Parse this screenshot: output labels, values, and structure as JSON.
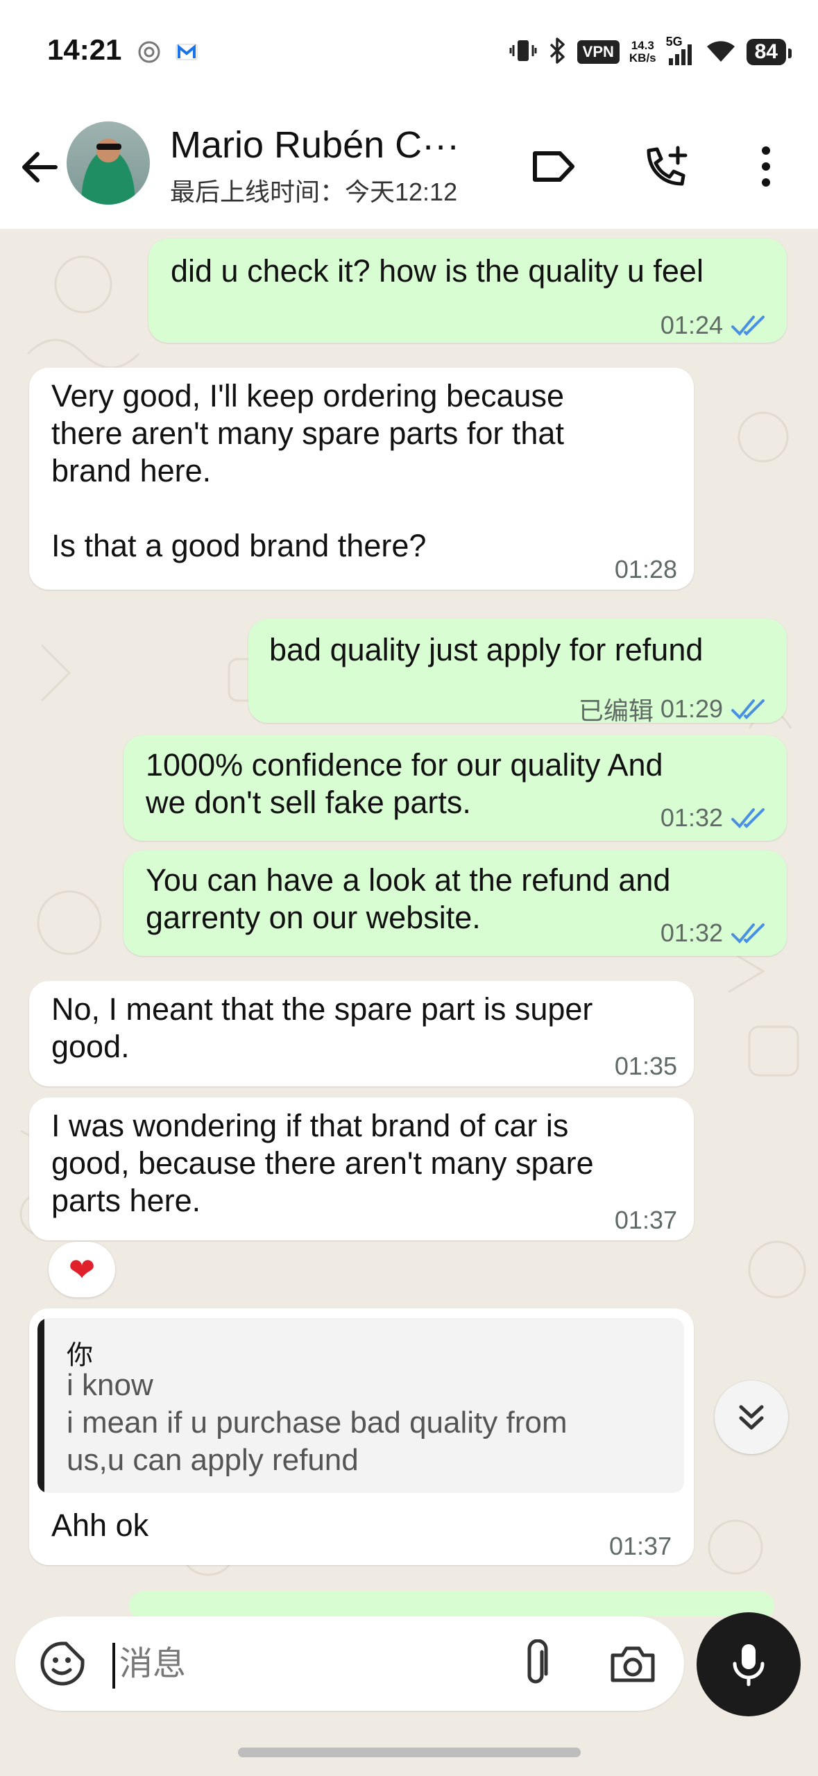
{
  "status_bar": {
    "time": "14:21",
    "vpn": "VPN",
    "speed_value": "14.3",
    "speed_unit": "KB/s",
    "network": "5G",
    "battery": "84",
    "icons": [
      "settings-circle-icon",
      "gmail-icon",
      "vibrate-icon",
      "bluetooth-icon",
      "signal-icon",
      "wifi-icon"
    ]
  },
  "header": {
    "contact_name": "Mario Rubén C···",
    "last_seen": "最后上线时间：今天12:12",
    "icons": [
      "back-arrow-icon",
      "label-tag-icon",
      "add-call-icon",
      "more-vert-icon"
    ]
  },
  "messages": [
    {
      "id": "m1",
      "direction": "out",
      "text": "did u check it? how is the quality u feel",
      "time": "01:24",
      "status": "read"
    },
    {
      "id": "m2",
      "direction": "in",
      "text": "Very good, I'll keep ordering because\nthere aren't many spare parts for that\nbrand here.\n\nIs that a good brand there?",
      "time": "01:28"
    },
    {
      "id": "m3",
      "direction": "out",
      "text": "bad quality just apply for refund",
      "edited_label": "已编辑",
      "time": "01:29",
      "status": "read"
    },
    {
      "id": "m4",
      "direction": "out",
      "text": "1000% confidence for our quality And\nwe don't sell fake parts.",
      "time": "01:32",
      "status": "read"
    },
    {
      "id": "m5",
      "direction": "out",
      "text": "You can have a look at the refund and\ngarrenty on our website.",
      "time": "01:32",
      "status": "read"
    },
    {
      "id": "m6",
      "direction": "in",
      "text": "No, I meant that the spare part is super\ngood.",
      "time": "01:35"
    },
    {
      "id": "m7",
      "direction": "in",
      "text": "I was wondering if that brand of car is\ngood, because there aren't many spare\nparts here.",
      "time": "01:37",
      "reaction": "❤"
    },
    {
      "id": "m8",
      "direction": "in",
      "quoted": {
        "author": "你",
        "text": "i know\ni mean if u purchase bad quality from\nus,u can apply refund"
      },
      "text": "Ahh ok",
      "time": "01:37"
    }
  ],
  "composer": {
    "placeholder": "消息",
    "icons": [
      "sticker-icon",
      "attach-icon",
      "camera-icon",
      "mic-icon"
    ]
  },
  "colors": {
    "outgoing_bubble": "#d9fdd3",
    "incoming_bubble": "#ffffff",
    "chat_background": "#efeae2",
    "read_ticks": "#4a90e2"
  }
}
